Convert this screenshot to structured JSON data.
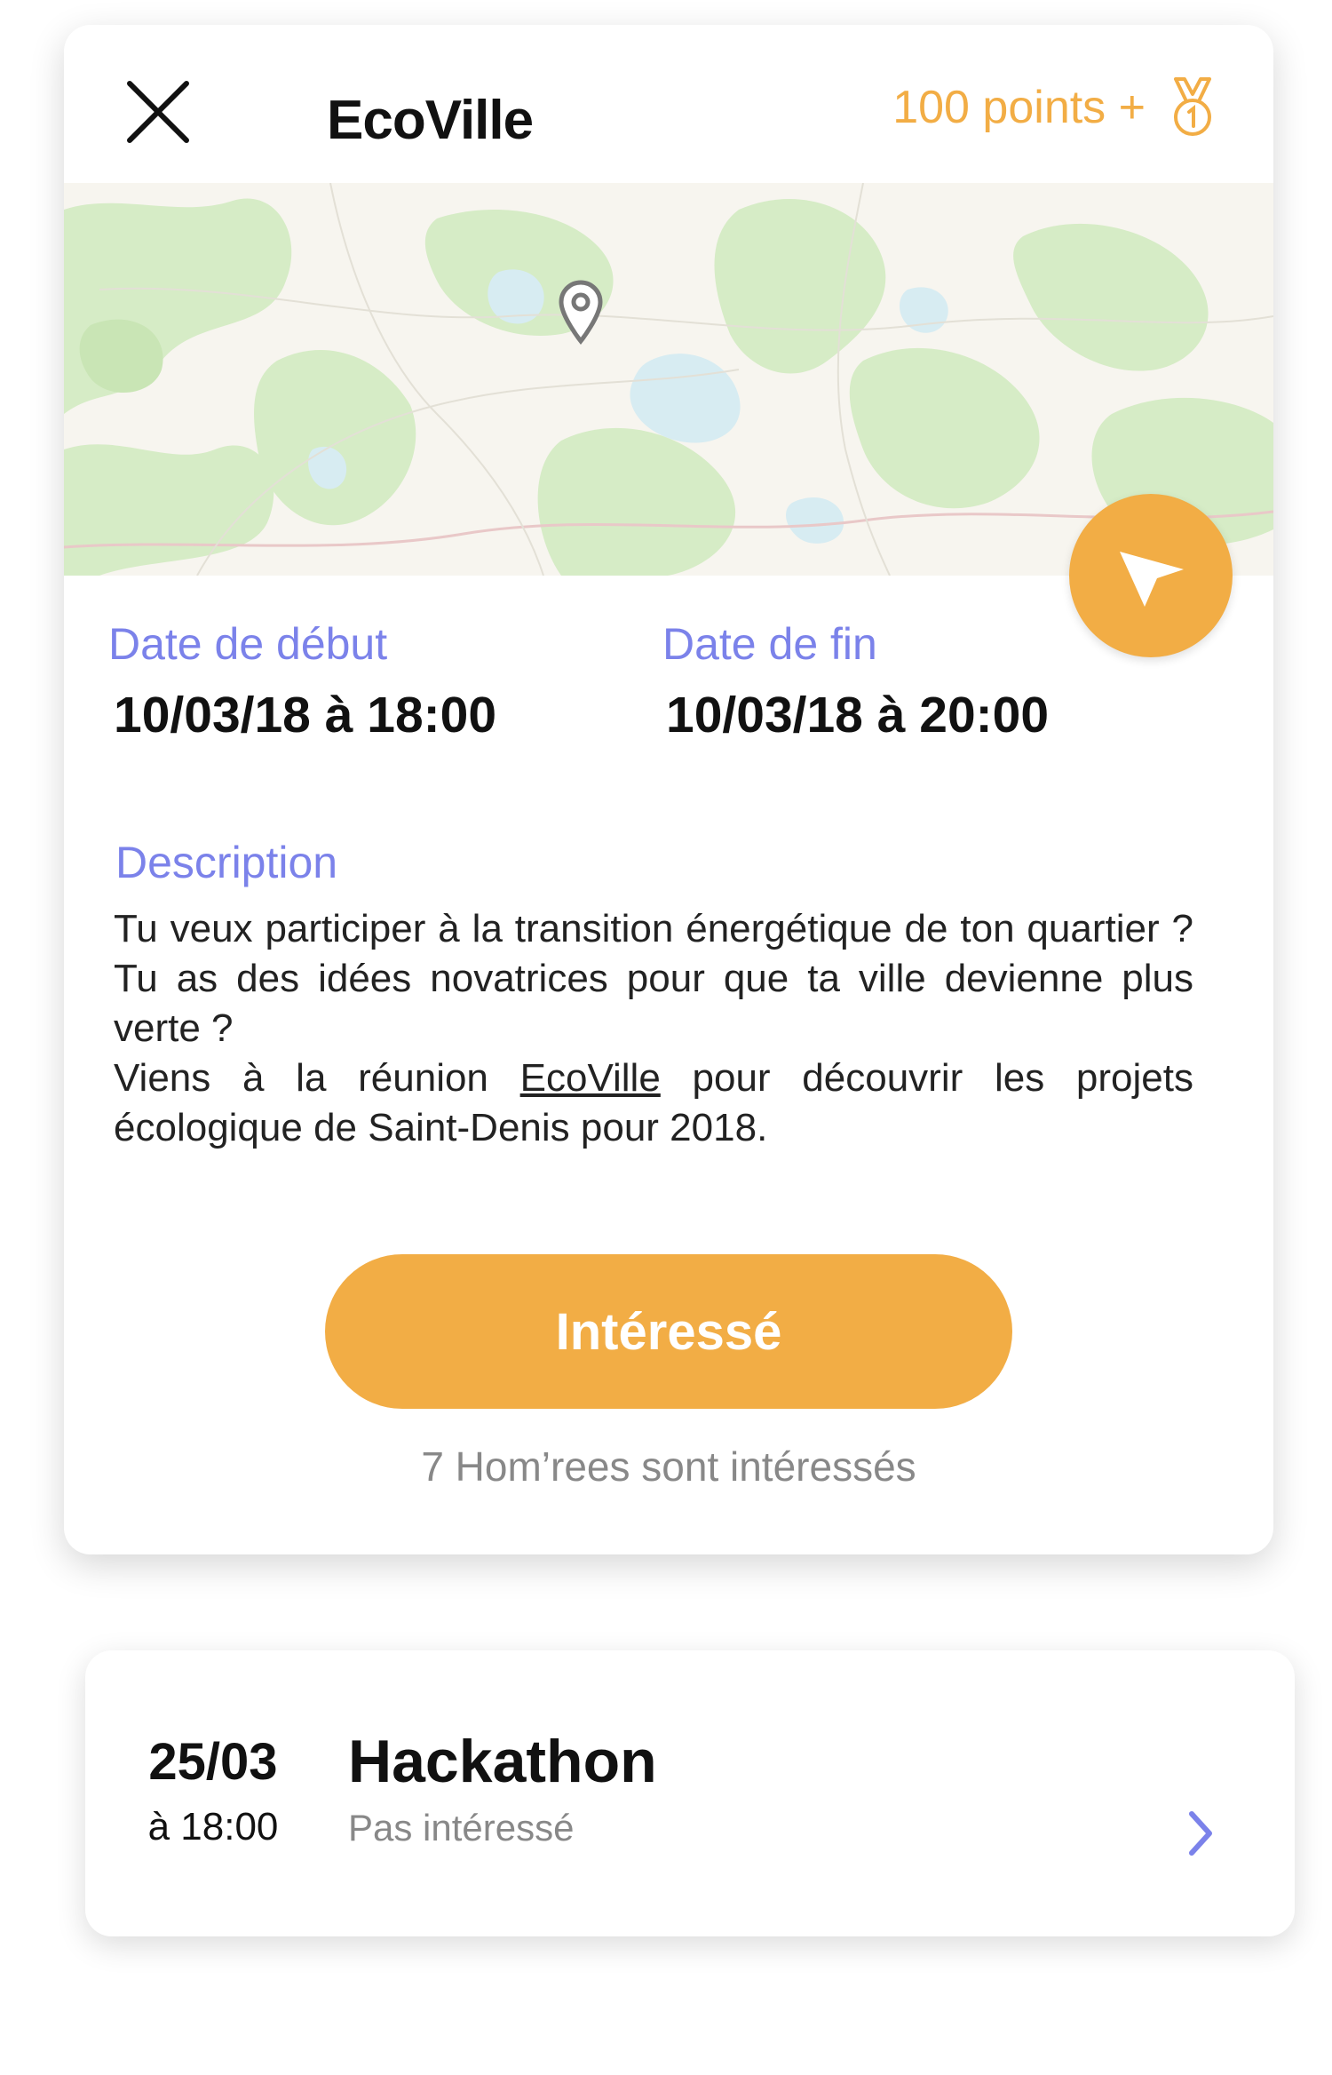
{
  "header": {
    "title": "EcoVille",
    "points_label": "100 points +"
  },
  "icons": {
    "close": "close-icon",
    "medal": "medal-icon",
    "location_pin": "location-pin-icon",
    "navigate": "navigation-arrow-icon",
    "chevron": "chevron-right-icon"
  },
  "colors": {
    "accent": "#f2ad45",
    "label": "#7b82ea",
    "map_land": "#f7f5ef",
    "map_green": "#d6ecc6",
    "map_water": "#d7ecf2"
  },
  "dates": {
    "start_label": "Date de début",
    "start_value": "10/03/18 à 18:00",
    "end_label": "Date de fin",
    "end_value": "10/03/18 à 20:00"
  },
  "description": {
    "label": "Description",
    "line1": "Tu veux participer à la transition énergétique de ton quartier ? Tu as des idées novatrices pour que ta ville devienne plus verte ?",
    "line2_before": "Viens à la réunion ",
    "line2_link": "EcoVille",
    "line2_after": " pour découvrir les projets écologique de Saint-Denis pour 2018."
  },
  "cta": {
    "label": "Intéressé",
    "count_text": "7 Hom’rees sont intéressés"
  },
  "next_event": {
    "date": "25/03",
    "time": "à 18:00",
    "title": "Hackathon",
    "status": "Pas intéressé"
  }
}
